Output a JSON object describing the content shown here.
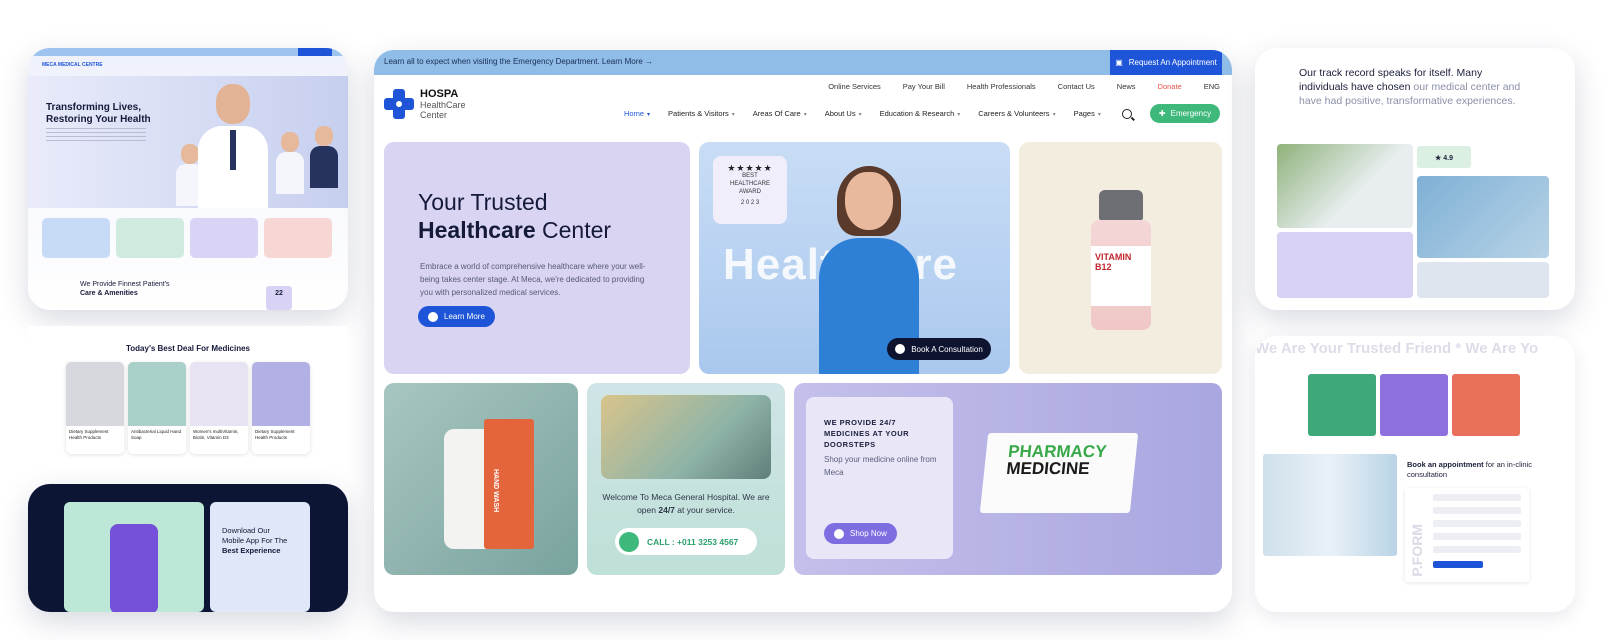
{
  "main": {
    "topbar": {
      "notice": "Learn all to expect when visiting the Emergency Department. Learn More →",
      "request_button": "Request An Appointment"
    },
    "brand": {
      "name": "HOSPA",
      "tagline_1": "HealthCare",
      "tagline_2": "Center"
    },
    "utility_nav": [
      "Online Services",
      "Pay Your Bill",
      "Health Professionals",
      "Contact Us",
      "News",
      "Donate",
      "ENG"
    ],
    "main_nav": [
      {
        "label": "Home",
        "caret": "▾"
      },
      {
        "label": "Patients & Visitors",
        "caret": "▾"
      },
      {
        "label": "Areas Of Care",
        "caret": "▾"
      },
      {
        "label": "About Us",
        "caret": "▾"
      },
      {
        "label": "Education & Research",
        "caret": "▾"
      },
      {
        "label": "Careers & Volunteers",
        "caret": "▾"
      },
      {
        "label": "Pages",
        "caret": "▾"
      }
    ],
    "emergency_button": "Emergency",
    "hero": {
      "title_line1": "Your Trusted",
      "title_bold": "Healthcare",
      "title_rest": " Center",
      "description": "Embrace a world of comprehensive healthcare where your well-being takes center stage. At Meca, we're dedicated to providing you with personalized medical services.",
      "learn_more": "Learn More",
      "bg_word": "Healthcare",
      "award": {
        "stars": "★★★★★",
        "line1": "BEST",
        "line2": "HEALTHCARE",
        "line3": "AWARD",
        "year": "2 0 2 3"
      },
      "consult_button": "Book A Consultation"
    },
    "vial_label": "VITAMIN B12",
    "handwash_label": "HAND WASH",
    "welcome": {
      "text_pre": "Welcome To Meca General Hospital. We are open ",
      "text_bold": "24/7",
      "text_post": " at your service.",
      "call_label": "CALL : +011 3253 4567"
    },
    "pharmacy": {
      "heading": "WE PROVIDE 24/7 MEDICINES AT YOUR DOORSTEPS",
      "text": "Shop your medicine online from Meca",
      "shop_button": "Shop Now",
      "box_word1": "PHARMACY",
      "box_word2": "MEDICINE"
    }
  },
  "left": {
    "logo": "MECA MEDICAL CENTRE",
    "hero_title_1": "Transforming Lives,",
    "hero_title_2": "Restoring Your Health",
    "section_title_1": "We Provide Finnest Patient's",
    "section_title_2": "Care & Amenities",
    "stat": "22",
    "deal_title_pre": "Today's Best Deal ",
    "deal_title_bold": "For Medicines",
    "products": [
      {
        "name": "Dietary Supplement Health Products"
      },
      {
        "name": "Antibacterial Liquid Hand Soap"
      },
      {
        "name": "Women's multiVitamin, Biotin, Vitamin D3"
      },
      {
        "name": "Dietary Supplement Health Products"
      }
    ],
    "app_title_1": "Download Our",
    "app_title_2": "Mobile App For The",
    "app_title_bold": "Best Experience"
  },
  "right": {
    "headline_dark": "Our track record speaks for itself. Many individuals have chosen",
    "headline_muted": " our medical center and have had positive, transformative experiences.",
    "rating": "★ 4.9",
    "marquee": "We Are Your Trusted Friend  * We Are Yo",
    "book_bold": "Book an appointment",
    "book_rest": " for an in-clinic consultation",
    "form_label": "P.FORM"
  },
  "colors": {
    "primary": "#1e55d8",
    "green": "#3fb87c",
    "lavender": "#d9d4f2",
    "donate": "#e8524a"
  }
}
